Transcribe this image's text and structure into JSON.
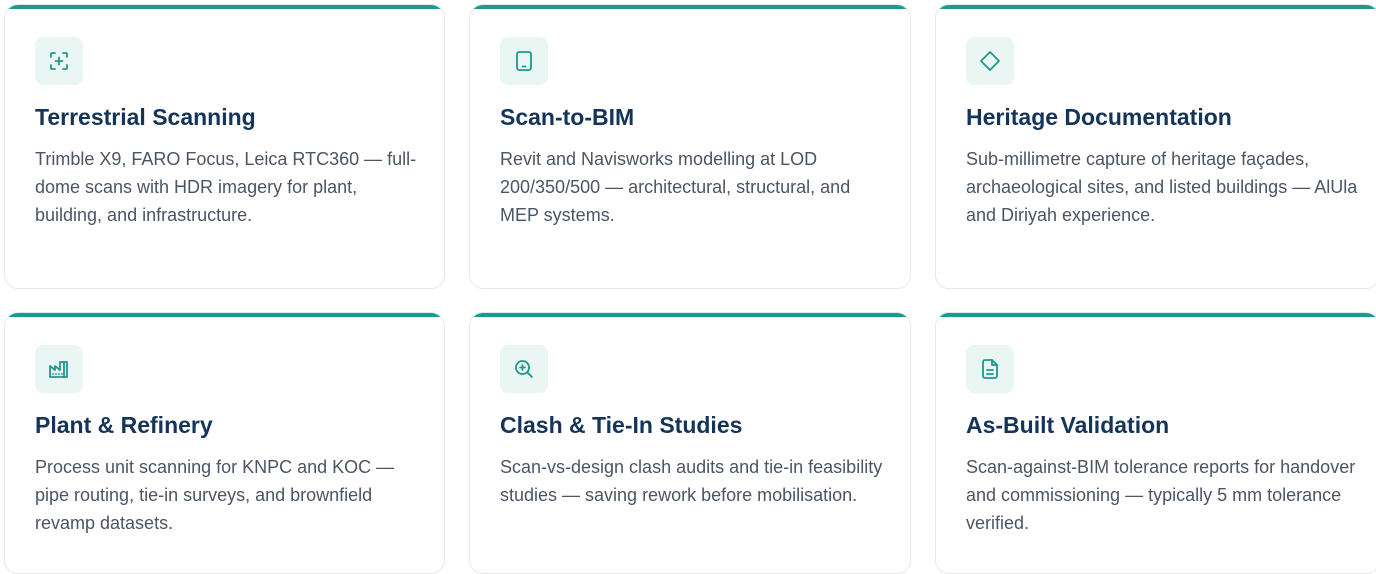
{
  "colors": {
    "accent": "#1c9a8a",
    "icon_bg": "#e9f6f4",
    "title": "#14345a",
    "text": "#4b5563",
    "border": "#e2e8ee"
  },
  "cards": [
    {
      "icon": "scan-focus-icon",
      "title": "Terrestrial Scanning",
      "description": "Trimble X9, FARO Focus, Leica RTC360 — full-dome scans with HDR imagery for plant, building, and infrastructure."
    },
    {
      "icon": "tablet-icon",
      "title": "Scan-to-BIM",
      "description": "Revit and Navisworks modelling at LOD 200/350/500 — architectural, structural, and MEP systems."
    },
    {
      "icon": "diamond-icon",
      "title": "Heritage Documentation",
      "description": "Sub-millimetre capture of heritage façades, archaeological sites, and listed buildings — AlUla and Diriyah experience."
    },
    {
      "icon": "factory-icon",
      "title": "Plant & Refinery",
      "description": "Process unit scanning for KNPC and KOC — pipe routing, tie-in surveys, and brownfield revamp datasets."
    },
    {
      "icon": "zoom-in-icon",
      "title": "Clash & Tie-In Studies",
      "description": "Scan-vs-design clash audits and tie-in feasibility studies — saving rework before mobilisation."
    },
    {
      "icon": "document-icon",
      "title": "As-Built Validation",
      "description": "Scan-against-BIM tolerance reports for handover and commissioning — typically 5 mm tolerance verified."
    }
  ]
}
